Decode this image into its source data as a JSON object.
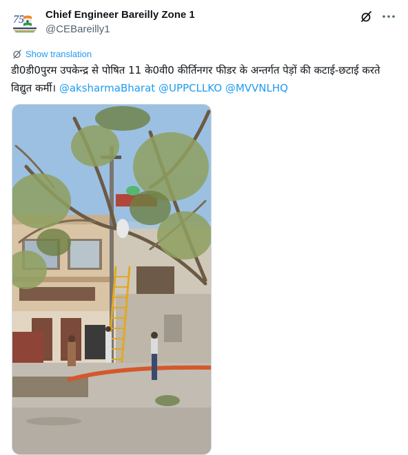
{
  "author": {
    "display_name": "Chief Engineer Bareilly Zone 1",
    "handle": "@CEBareilly1",
    "avatar_icon": "azadi-ka-amrit-mahotsav-75-logo",
    "avatar_text": "75"
  },
  "actions": {
    "grok_icon": "grok-icon",
    "more_icon": "more-horizontal-icon"
  },
  "translation": {
    "label": "Show translation",
    "icon": "translate-icon"
  },
  "tweet": {
    "text": "डी0डी0पुरम उपकेन्द्र से पोषित 11 के0वी0 कीर्तिनगर फीडर के अन्तर्गत पेड़ों की कटाई-छटाई करते विद्युत कर्मी।",
    "mentions": [
      "@aksharmaBharat",
      "@UPPCLLKO",
      "@MVVNLHQ"
    ]
  },
  "media": {
    "type": "photo"
  },
  "colors": {
    "link": "#1d9bf0",
    "text": "#0f1419",
    "secondary": "#536471",
    "border": "#cfd9de"
  }
}
